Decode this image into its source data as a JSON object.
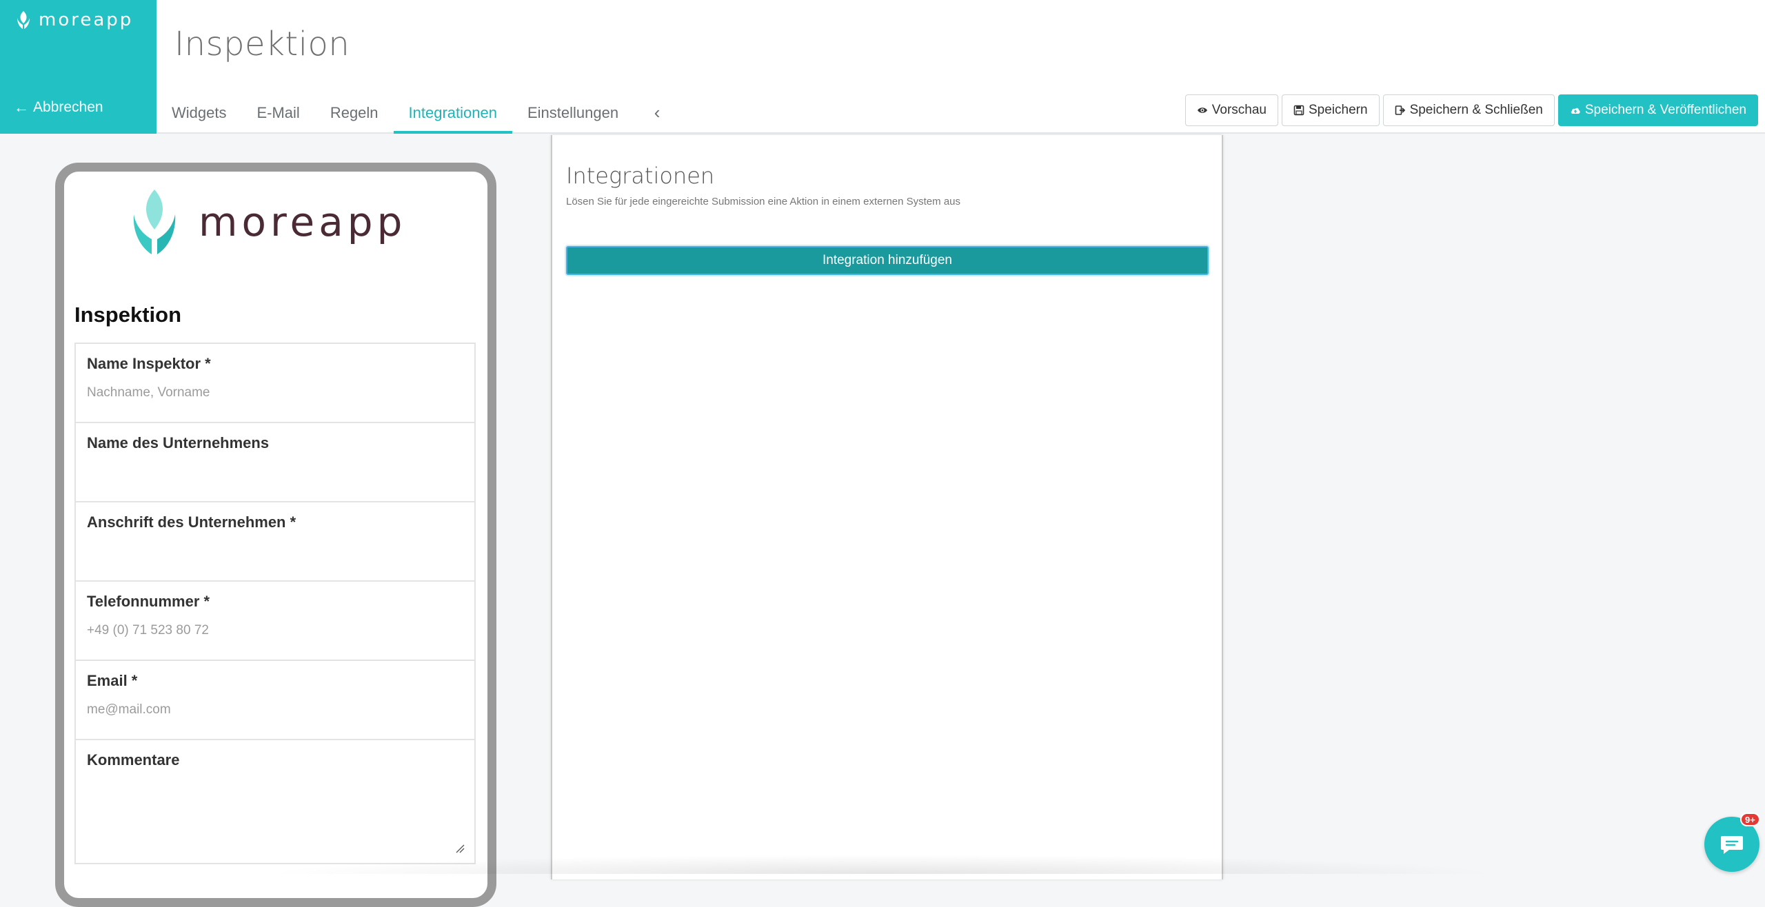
{
  "brand": {
    "name": "moreapp"
  },
  "header": {
    "cancel_label": "Abbrechen",
    "page_title": "Inspektion"
  },
  "tabs": [
    {
      "label": "Widgets"
    },
    {
      "label": "E-Mail"
    },
    {
      "label": "Regeln"
    },
    {
      "label": "Integrationen",
      "active": true
    },
    {
      "label": "Einstellungen"
    }
  ],
  "actions": {
    "preview": "Vorschau",
    "save": "Speichern",
    "save_close": "Speichern & Schließen",
    "save_publish": "Speichern & Veröffentlichen"
  },
  "phone_preview": {
    "brand": "moreapp",
    "form_title": "Inspektion",
    "fields": [
      {
        "label": "Name Inspektor *",
        "placeholder": "Nachname, Vorname"
      },
      {
        "label": "Name des Unternehmens",
        "placeholder": ""
      },
      {
        "label": "Anschrift des Unternehmen *",
        "placeholder": ""
      },
      {
        "label": "Telefonnummer *",
        "placeholder": "+49 (0) 71 523 80 72"
      },
      {
        "label": "Email *",
        "placeholder": "me@mail.com"
      },
      {
        "label": "Kommentare",
        "placeholder": ""
      }
    ]
  },
  "integrations_panel": {
    "title": "Integrationen",
    "subtitle": "Lösen Sie für jede eingereichte Submission eine Aktion in einem externen System aus",
    "add_button": "Integration hinzufügen"
  },
  "chat": {
    "badge": "9+"
  },
  "colors": {
    "accent": "#22c1c3",
    "accent_dark": "#1a9a9c",
    "badge": "#e53935"
  }
}
